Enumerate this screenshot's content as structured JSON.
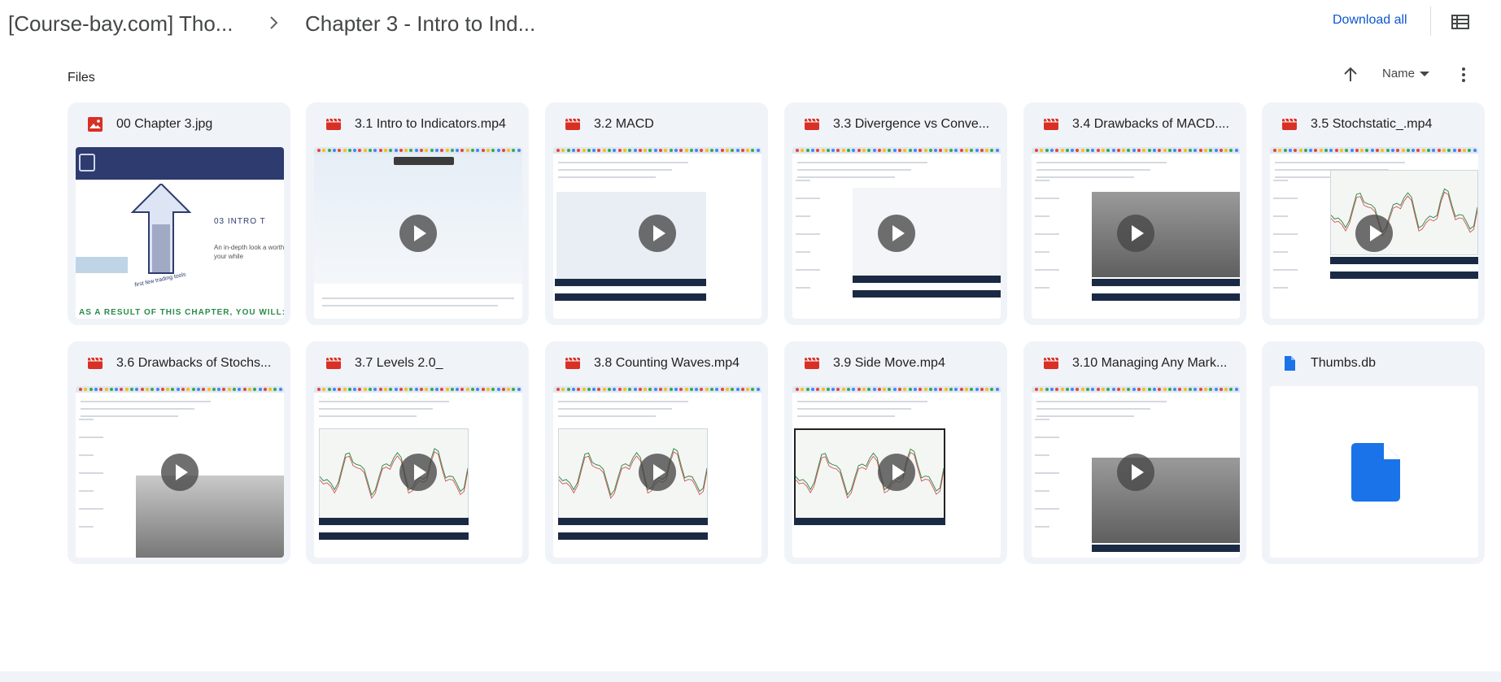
{
  "breadcrumb": {
    "root": "[Course-bay.com] Tho...",
    "current": "Chapter 3 - Intro to Ind..."
  },
  "toolbar": {
    "download_all": "Download all"
  },
  "files_label": "Files",
  "sort": {
    "field": "Name"
  },
  "colors": {
    "accent": "#0b57d0",
    "video_icon": "#d93025",
    "image_icon": "#d93025",
    "doc_icon": "#1a73e8",
    "card_bg": "#f0f4f9"
  },
  "files": [
    {
      "name": "00 Chapter 3.jpg",
      "icon": "image-icon",
      "kind": "image",
      "thumb_text": {
        "heading": "03 INTRO T",
        "sub": "An in-depth look a worth your while",
        "caption": "first few trading tools",
        "bottom": "AS A RESULT OF THIS CHAPTER, YOU WILL:"
      }
    },
    {
      "name": "3.1 Intro to Indicators.mp4",
      "icon": "video-icon",
      "kind": "video"
    },
    {
      "name": "3.2 MACD",
      "icon": "video-icon",
      "kind": "video"
    },
    {
      "name": "3.3 Divergence vs Conve...",
      "icon": "video-icon",
      "kind": "video"
    },
    {
      "name": "3.4 Drawbacks of MACD....",
      "icon": "video-icon",
      "kind": "video"
    },
    {
      "name": "3.5 Stochstatic_.mp4",
      "icon": "video-icon",
      "kind": "video"
    },
    {
      "name": "3.6 Drawbacks of Stochs...",
      "icon": "video-icon",
      "kind": "video"
    },
    {
      "name": "3.7 Levels 2.0_",
      "icon": "video-icon",
      "kind": "video"
    },
    {
      "name": "3.8 Counting Waves.mp4",
      "icon": "video-icon",
      "kind": "video"
    },
    {
      "name": "3.9 Side Move.mp4",
      "icon": "video-icon",
      "kind": "video"
    },
    {
      "name": "3.10 Managing Any Mark...",
      "icon": "video-icon",
      "kind": "video"
    },
    {
      "name": "Thumbs.db",
      "icon": "file-icon",
      "kind": "doc"
    }
  ]
}
